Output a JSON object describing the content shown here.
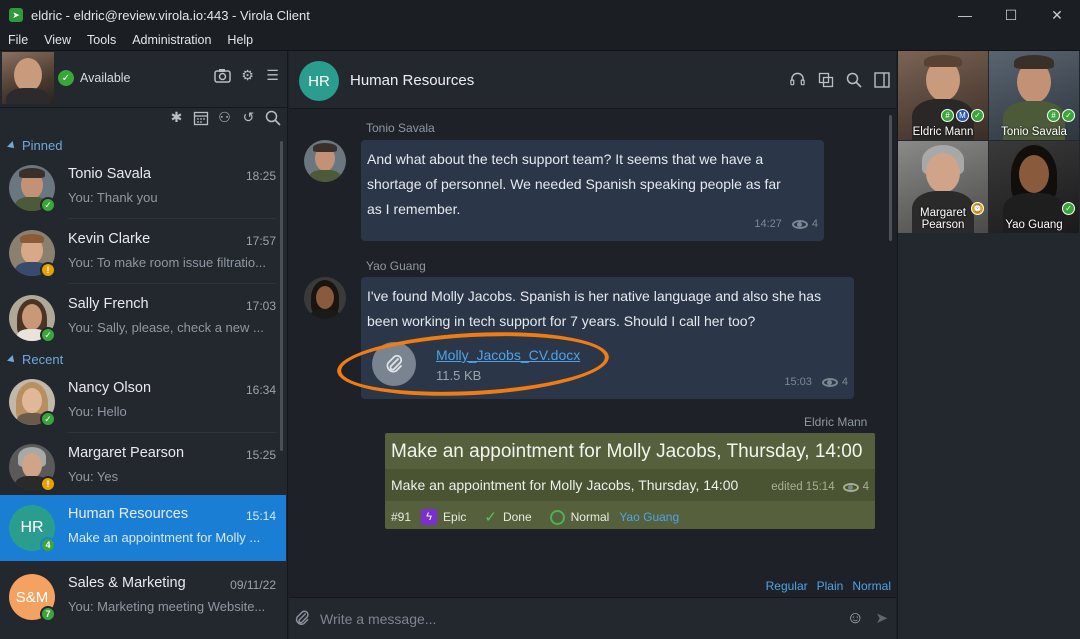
{
  "window": {
    "title": "eldric - eldric@review.virola.io:443 - Virola Client",
    "minimize": "—",
    "maximize": "☐",
    "close": "✕"
  },
  "menu": [
    "File",
    "View",
    "Tools",
    "Administration",
    "Help"
  ],
  "me": {
    "status": "Available"
  },
  "groups": {
    "pinned": "Pinned",
    "recent": "Recent"
  },
  "contacts": [
    {
      "name": "Tonio Savala",
      "time": "18:25",
      "last": "You: Thank you",
      "status": "online"
    },
    {
      "name": "Kevin Clarke",
      "time": "17:57",
      "last": "You: To make room issue filtratio...",
      "status": "away"
    },
    {
      "name": "Sally French",
      "time": "17:03",
      "last": "You: Sally, please, check a new ...",
      "status": "online"
    },
    {
      "name": "Nancy Olson",
      "time": "16:34",
      "last": "You: Hello",
      "status": "online"
    },
    {
      "name": "Margaret Pearson",
      "time": "15:25",
      "last": "You: Yes",
      "status": "away"
    },
    {
      "name": "Human Resources",
      "initials": "HR",
      "time": "15:14",
      "last": "Make an appointment for Molly ...",
      "badge": "4",
      "selected": true
    },
    {
      "name": "Sales & Marketing",
      "initials": "S&M",
      "time": "09/11/22",
      "last": "You: Marketing meeting Website...",
      "badge": "7"
    }
  ],
  "chat": {
    "initials": "HR",
    "title": "Human Resources",
    "messages": [
      {
        "author": "Tonio Savala",
        "text_lines": [
          "And what about the tech support team? It seems that we have a",
          "shortage of personnel. We needed Spanish speaking people as far",
          "as I remember."
        ],
        "time": "14:27",
        "views": "4"
      },
      {
        "author": "Yao Guang",
        "text_lines": [
          "I've found Molly Jacobs. Spanish is her native language and also she has",
          "been working in tech support for 7 years. Should I call her too?"
        ],
        "file_name": "Molly_Jacobs_CV.docx",
        "file_size": "11.5 KB",
        "time": "15:03",
        "views": "4"
      }
    ],
    "task": {
      "author": "Eldric Mann",
      "title": "Make an appointment for Molly Jacobs, Thursday, 14:00",
      "description": "Make an appointment for Molly Jacobs, Thursday, 14:00",
      "edited": "edited 15:14",
      "views": "4",
      "number": "#91",
      "type": "Epic",
      "state": "Done",
      "priority": "Normal",
      "assignee": "Yao Guang"
    },
    "format": [
      "Regular",
      "Plain",
      "Normal"
    ],
    "composer_placeholder": "Write a message..."
  },
  "participants": [
    {
      "name": "Eldric Mann",
      "badges": [
        "#",
        "M",
        "✓"
      ]
    },
    {
      "name": "Tonio Savala",
      "badges": [
        "#",
        "✓"
      ]
    },
    {
      "name": "Margaret Pearson",
      "badges": [
        "⌚"
      ]
    },
    {
      "name": "Yao Guang",
      "badges": [
        "✓"
      ]
    }
  ],
  "colors": {
    "accent": "#1a7fd4",
    "online": "#3aa63a",
    "away": "#e8a100",
    "highlight": "#f07c14",
    "task_bg": "#56603c",
    "bubble_bg": "#2b3748"
  }
}
